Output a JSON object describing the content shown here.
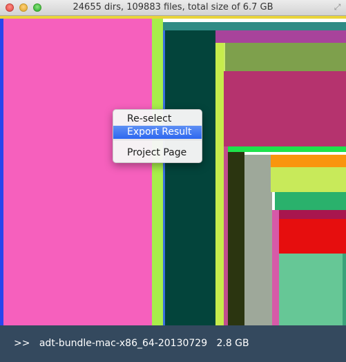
{
  "window": {
    "title": "24655 dirs, 109883 files, total size of 6.7 GB",
    "buttons": [
      "close-icon",
      "minimize-icon",
      "zoom-icon"
    ],
    "resize_icon": "fullscreen-arrows-icon",
    "resize_glyph": "⤢"
  },
  "treemap": {
    "blocks": [
      {
        "name": "block-main-pink",
        "color": "#f660bd"
      },
      {
        "name": "block-blue-strip",
        "color": "#2a45ee"
      },
      {
        "name": "block-yellow-top",
        "color": "#e9d43a"
      },
      {
        "name": "block-lime",
        "color": "#a8ee4a"
      },
      {
        "name": "block-teal-top",
        "color": "#2f8b85"
      },
      {
        "name": "block-dark-green",
        "color": "#03443b"
      },
      {
        "name": "block-purple-top",
        "color": "#a8439b"
      },
      {
        "name": "block-olive",
        "color": "#7ea04c"
      },
      {
        "name": "block-magenta",
        "color": "#b5336e"
      },
      {
        "name": "block-bright-green",
        "color": "#1ee34b"
      },
      {
        "name": "block-near-black",
        "color": "#2b3510"
      },
      {
        "name": "block-gray",
        "color": "#9ea89a"
      },
      {
        "name": "block-orange",
        "color": "#f9950e"
      },
      {
        "name": "block-yellow-green",
        "color": "#c8ea5a"
      },
      {
        "name": "block-jade",
        "color": "#2ab16c"
      },
      {
        "name": "block-red",
        "color": "#e60e0e"
      },
      {
        "name": "block-seafoam",
        "color": "#66c796"
      }
    ]
  },
  "context_menu": {
    "items": [
      "Re-select",
      "Export Result",
      "Project Page"
    ],
    "selected": "Export Result"
  },
  "status": {
    "prefix": ">>",
    "path": "adt-bundle-mac-x86_64-20130729",
    "size": "2.8 GB",
    "bg_color": "#34495e"
  }
}
